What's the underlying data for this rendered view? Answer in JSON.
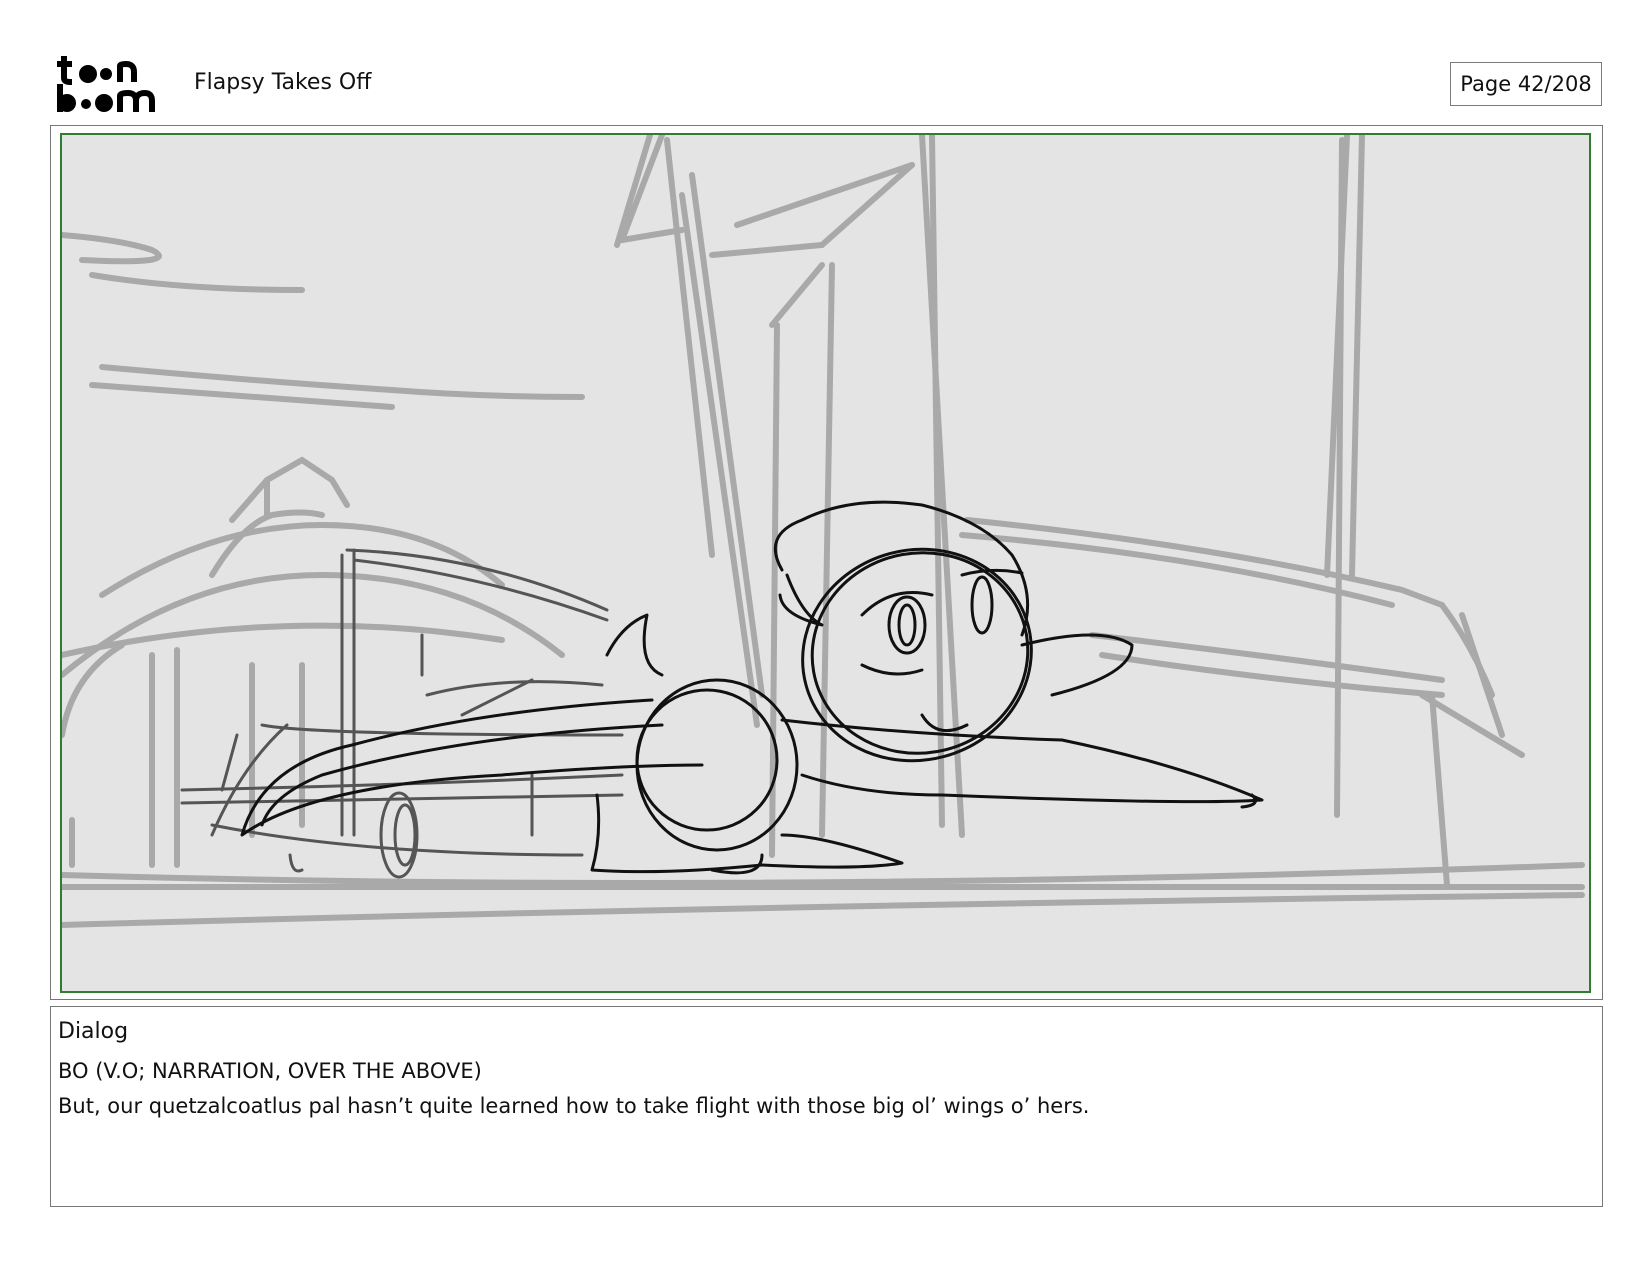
{
  "header": {
    "logo_top": "to•n",
    "logo_bottom": "b••m",
    "project_title": "Flapsy Takes Off",
    "page_label": "Page",
    "page_number": "42/208"
  },
  "dialog": {
    "label": "Dialog",
    "speaker": "BO (V.O; NARRATION, OVER THE ABOVE)",
    "line": "But, our quetzalcoatlus pal hasn’t quite learned how to take flight with those big ol’ wings o’ hers."
  },
  "colors": {
    "panel_border": "#2f7d2f",
    "panel_background": "#e4e4e4",
    "sketch_background": "#a9a9a9",
    "sketch_foreground": "#111111"
  }
}
